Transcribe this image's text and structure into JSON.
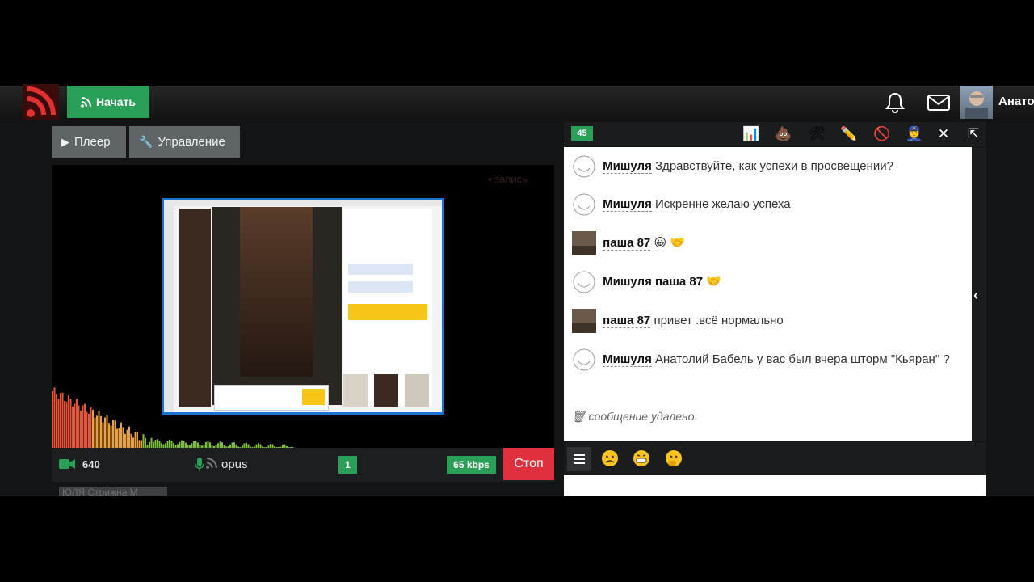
{
  "header": {
    "start_label": "Начать",
    "user_name": "Анатолий"
  },
  "tabs": [
    {
      "label": "Плеер",
      "icon": "play-icon"
    },
    {
      "label": "Управление",
      "icon": "wrench-icon"
    }
  ],
  "video": {
    "overlay_label": "• запись"
  },
  "status": {
    "resolution": "640",
    "codec": "opus",
    "count": "1",
    "bitrate": "65 kbps",
    "stop_label": "Стоп",
    "ghost_label": "ЮЛЯ Стрижна М"
  },
  "chat": {
    "online_count": "45",
    "toolbar_icons": [
      "chart-icon",
      "poop-icon",
      "tools-icon",
      "pencil-icon",
      "ban-icon",
      "police-icon",
      "fullscreen-icon",
      "external-link-icon"
    ],
    "messages": [
      {
        "nick": "Мишуля",
        "text": "Здравствуйте, как успехи в просвещении?"
      },
      {
        "nick": "Мишуля",
        "text": "Искренне желаю успеха"
      },
      {
        "nick": "паша 87",
        "text": "😀 🤝"
      },
      {
        "nick": "Мишуля",
        "text": "паша 87 🤝"
      },
      {
        "nick": "паша 87",
        "text": "привет .всё нормально"
      },
      {
        "nick": "Мишуля",
        "text": "Анатолий Бабель у вас был вчера шторм \"Кьяран\" ?"
      }
    ],
    "deleted_label": "сообщение удалено",
    "input_value": ""
  },
  "colors": {
    "accent": "#2a9f57",
    "danger": "#e02f3d",
    "background": "#121416"
  }
}
